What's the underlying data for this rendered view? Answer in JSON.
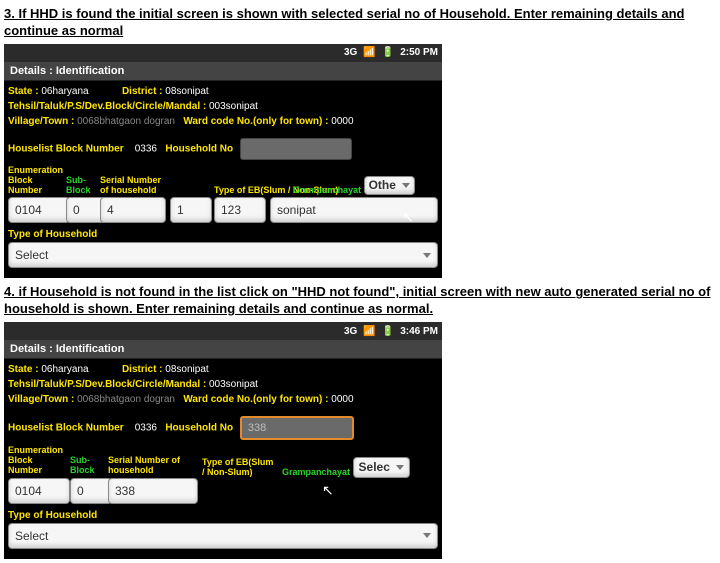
{
  "step3": {
    "text": "3. If HHD is found the initial screen is shown with selected serial no of Household. Enter remaining details and continue as normal"
  },
  "step4": {
    "text": "4. if Household is not found in the list click on \"HHD not found\", initial screen with new auto generated serial no of household is shown. Enter remaining details and continue as normal."
  },
  "screenA": {
    "statusbar": {
      "net": "3G",
      "time": "2:50 PM"
    },
    "title": "Details : Identification",
    "fields": {
      "state_label": "State :",
      "state_value": "06haryana",
      "district_label": "District :",
      "district_value": "08sonipat",
      "tehsil_label": "Tehsil/Taluk/P.S/Dev.Block/Circle/Mandal :",
      "tehsil_value": "003sonipat",
      "village_label": "Village/Town :",
      "village_value": "0068bhatgaon dogran",
      "ward_label": "Ward code No.(only for town) :",
      "ward_value": "0000",
      "hlist_label": "Houselist Block Number",
      "hlist_value": "0336",
      "hh_label": "Household No",
      "hh_value": ""
    },
    "cols": {
      "ebn_label": "Enumeration Block Number",
      "ebn_value": "0104",
      "sub_label": "Sub-Block",
      "sub_value": "0",
      "serial_label": "Serial Number of household",
      "serial_value": "4",
      "type_eb_label": "Type of EB(Slum / Non-Slum)",
      "type_eb_mid": "Grampanchayat",
      "extra1_value": "1",
      "extra2_value": "123",
      "type_eb_sel": "Othe",
      "panchayat_value": "sonipat"
    },
    "type_hh_label": "Type of Household",
    "select_label": "Select"
  },
  "screenB": {
    "statusbar": {
      "net": "3G",
      "time": "3:46 PM"
    },
    "title": "Details : Identification",
    "fields": {
      "state_label": "State :",
      "state_value": "06haryana",
      "district_label": "District :",
      "district_value": "08sonipat",
      "tehsil_label": "Tehsil/Taluk/P.S/Dev.Block/Circle/Mandal :",
      "tehsil_value": "003sonipat",
      "village_label": "Village/Town :",
      "village_value": "0068bhatgaon dogran",
      "ward_label": "Ward code No.(only for town) :",
      "ward_value": "0000",
      "hlist_label": "Houselist Block Number",
      "hlist_value": "0336",
      "hh_label": "Household No",
      "hh_value": "338"
    },
    "cols": {
      "ebn_label": "Enumeration Block Number",
      "ebn_value": "0104",
      "sub_label": "Sub-Block",
      "sub_value": "0",
      "serial_label": "Serial Number of household",
      "serial_value": "338",
      "type_eb_label": "Type of EB(Slum / Non-Slum)",
      "type_eb_mid": "Grampanchayat",
      "type_eb_sel": "Selec"
    },
    "type_hh_label": "Type of Household",
    "select_label": "Select"
  }
}
